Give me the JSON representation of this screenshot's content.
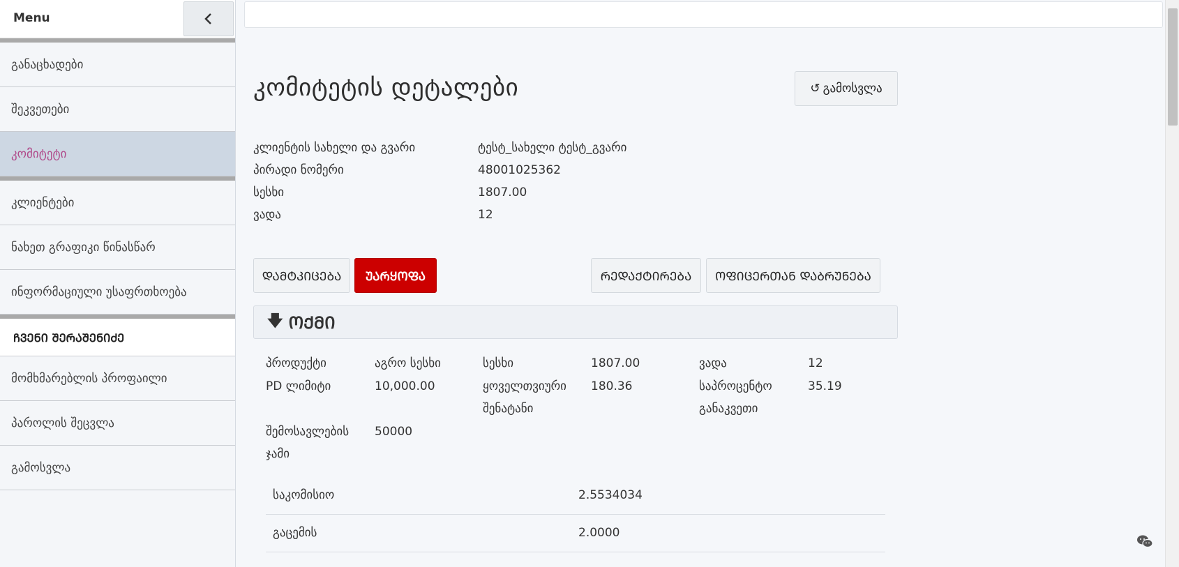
{
  "sidebar": {
    "title": "Menu",
    "items_top": [
      {
        "label": "განაცხადები"
      },
      {
        "label": "შეკვეთები"
      },
      {
        "label": "კომიტეტი"
      }
    ],
    "items_mid": [
      {
        "label": "კლიენტები"
      },
      {
        "label": "ნახეთ გრაფიკი წინასწარ"
      },
      {
        "label": "ინფორმაციული უსაფრთხოება"
      }
    ],
    "section_title": "ᲩᲕᲔᲜᲘ ᲨᲔᲠᲐᲨᲔᲜᲘᲫᲔ",
    "items_bottom": [
      {
        "label": "მომხმარებლის პროფაილი"
      },
      {
        "label": "პაროლის შეცვლა"
      },
      {
        "label": "გამოსვლა"
      }
    ]
  },
  "page": {
    "title": "კომიტეტის დეტალები",
    "back_button": "გამოსვლა"
  },
  "info": [
    {
      "label": "კლიენტის სახელი და გვარი",
      "value": "ტესტ_სახელი ტესტ_გვარი"
    },
    {
      "label": "პირადი ნომერი",
      "value": "48001025362"
    },
    {
      "label": "სესხი",
      "value": "1807.00"
    },
    {
      "label": "ვადა",
      "value": "12"
    }
  ],
  "actions": {
    "approve": "ᲓᲐᲛᲢᲙᲘᲪᲔᲑᲐ",
    "reject": "ᲣᲐᲠᲧᲝᲤᲐ",
    "edit": "ᲠᲔᲓᲐᲥᲢᲘᲠᲔᲑᲐ",
    "return": "ᲝᲤᲘᲪᲔᲠᲗᲐᲜ ᲓᲐᲑᲠᲣᲜᲔᲑᲐ"
  },
  "accordion": {
    "title": "ᲝᲥᲛᲘ"
  },
  "details": [
    {
      "label": "პროდუქტი",
      "value": "აგრო სესხი"
    },
    {
      "label": "სესხი",
      "value": "1807.00"
    },
    {
      "label": "ვადა",
      "value": "12"
    },
    {
      "label": "PD ლიმიტი",
      "value": "10,000.00"
    },
    {
      "label": "ყოველთვიური შენატანი",
      "value": "180.36"
    },
    {
      "label": "საპროცენტო განაკვეთი",
      "value": "35.19"
    },
    {
      "label": "შემოსავლების ჯამი",
      "value": "50000"
    }
  ],
  "table": [
    {
      "key": "საკომისიო",
      "value": "2.5534034"
    },
    {
      "key": "გაცემის",
      "value": "2.0000"
    }
  ]
}
